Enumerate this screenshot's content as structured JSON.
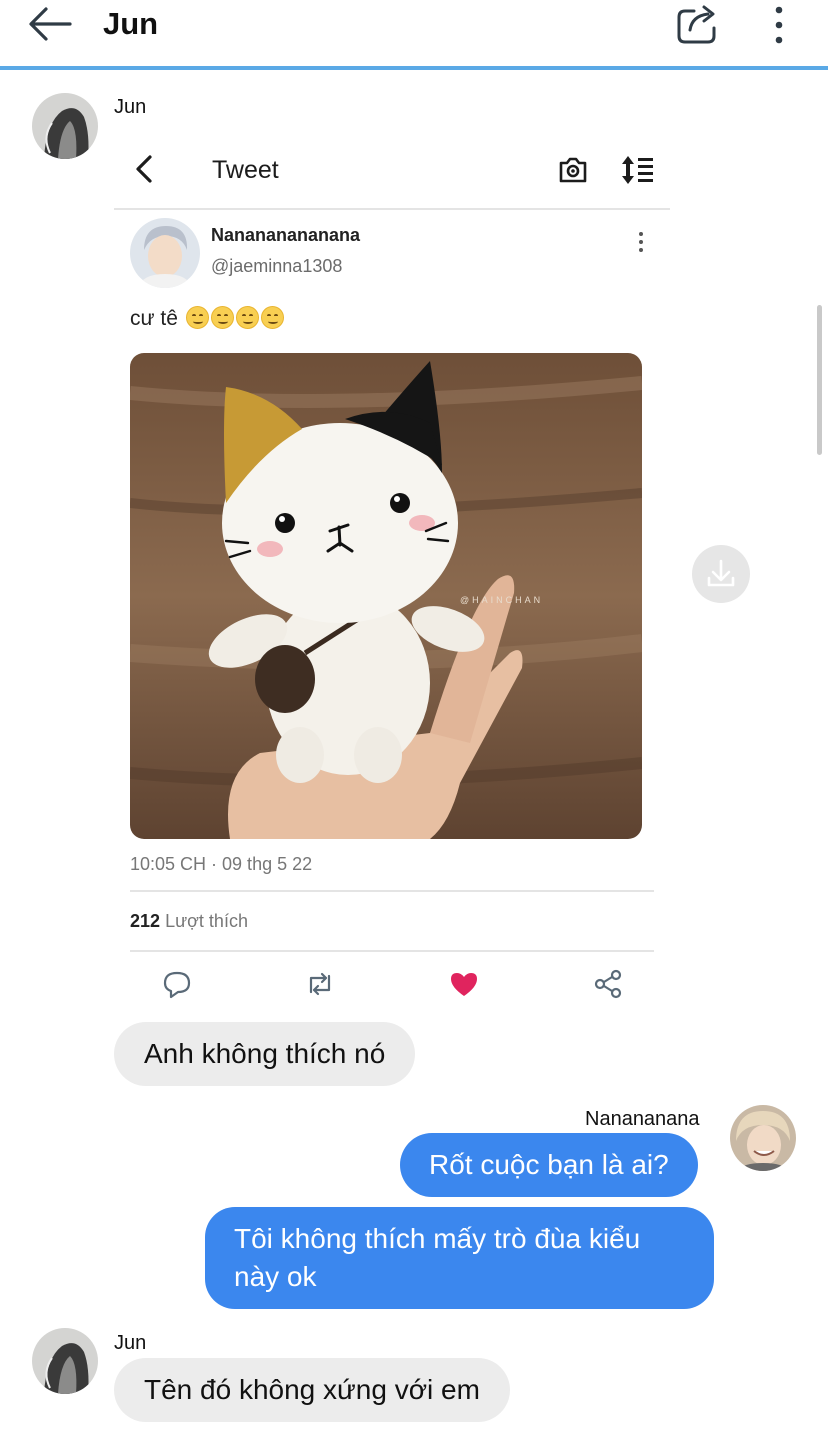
{
  "header": {
    "title": "Jun",
    "back_icon": "arrow-left-icon",
    "share_icon": "share-icon",
    "more_icon": "more-vertical-icon"
  },
  "colors": {
    "header_underline": "#5aa9e6",
    "incoming_bubble": "#ececec",
    "outgoing_bubble": "#3b87ee",
    "like_heart": "#e0245e"
  },
  "tweet": {
    "header_title": "Tweet",
    "display_name": "Nanananananana",
    "handle": "@jaeminna1308",
    "text": "cư tê",
    "emoji_count": 4,
    "photo_watermark": "@HAINCHAN",
    "timestamp": "10:05 CH · 09 thg 5 22",
    "likes_count": "212",
    "likes_label": "Lượt thích",
    "actions": [
      "reply-icon",
      "retweet-icon",
      "like-icon",
      "share-icon"
    ]
  },
  "messages": [
    {
      "sender": "Jun",
      "direction": "in",
      "text": "Anh không thích nó"
    },
    {
      "sender": "Nanananana",
      "direction": "out",
      "text": "Rốt cuộc bạn là ai?"
    },
    {
      "sender": "Nanananana",
      "direction": "out",
      "text": "Tôi không thích mấy trò đùa kiểu này ok"
    },
    {
      "sender": "Jun",
      "direction": "in",
      "text": "Tên đó không xứng với em"
    }
  ]
}
